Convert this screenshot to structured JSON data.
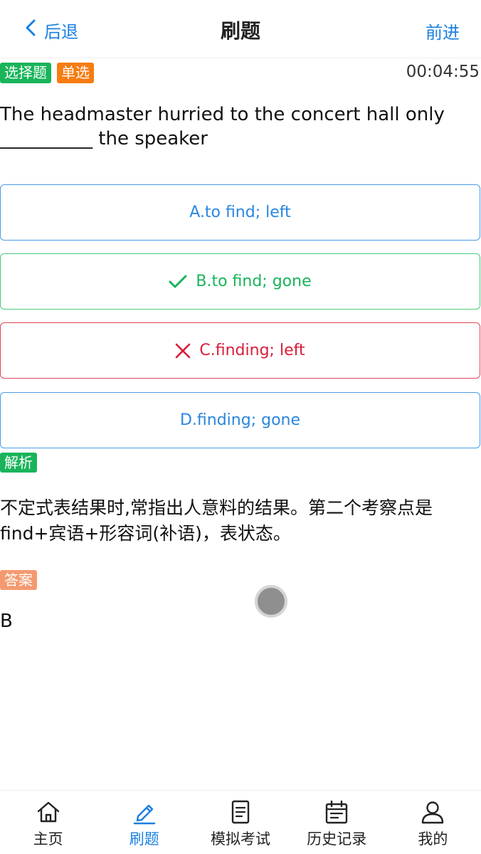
{
  "header": {
    "back_label": "后退",
    "title": "刷题",
    "forward_label": "前进"
  },
  "question": {
    "type_tag": "选择题",
    "mode_tag": "单选",
    "timer": "00:04:55",
    "text": "The headmaster hurried to the concert hall only __________ the speaker"
  },
  "options": [
    {
      "label": "A.to find; left",
      "state": "normal"
    },
    {
      "label": "B.to find; gone",
      "state": "correct",
      "icon": "check-icon"
    },
    {
      "label": "C.finding; left",
      "state": "wrong",
      "icon": "cross-icon"
    },
    {
      "label": "D.finding; gone",
      "state": "normal"
    }
  ],
  "analysis": {
    "badge": "解析",
    "text": "不定式表结果时,常指出人意料的结果。第二个考察点是find+宾语+形容词(补语)，表状态。"
  },
  "answer": {
    "badge": "答案",
    "text": "B"
  },
  "nav": {
    "items": [
      {
        "label": "主页",
        "icon": "home-icon"
      },
      {
        "label": "刷题",
        "icon": "pencil-icon",
        "active": true
      },
      {
        "label": "模拟考试",
        "icon": "document-icon"
      },
      {
        "label": "历史记录",
        "icon": "calendar-icon"
      },
      {
        "label": "我的",
        "icon": "user-icon"
      }
    ]
  },
  "colors": {
    "accent": "#1a7fe0",
    "correct": "#19b45a",
    "wrong": "#d81e3a",
    "single_tag": "#f77c12",
    "answer_badge": "#f49a70"
  }
}
